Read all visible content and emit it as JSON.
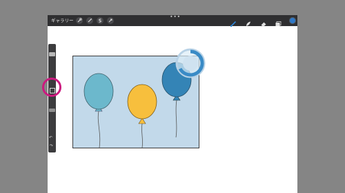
{
  "toolbar": {
    "gallery_label": "ギャラリー",
    "left_icons": [
      "wrench-icon",
      "magic-wand-icon",
      "selection-s-icon",
      "transform-arrow-icon"
    ],
    "more_label": "•••",
    "right_icons": [
      "brush-icon",
      "smudge-icon",
      "eraser-icon",
      "layers-icon"
    ],
    "active_color": "#2e78c8"
  },
  "sidebar": {
    "modify_label": "□",
    "undo_label": "↶",
    "redo_label": "↷"
  },
  "canvas": {
    "background": "#c2d9ea",
    "balloons": [
      "teal-balloon",
      "yellow-balloon",
      "blue-balloon"
    ]
  },
  "colors": {
    "highlight": "#cc1a7f",
    "balloon_teal": "#6cb8cc",
    "balloon_yellow": "#f7bf3d",
    "balloon_blue": "#3484b6"
  }
}
